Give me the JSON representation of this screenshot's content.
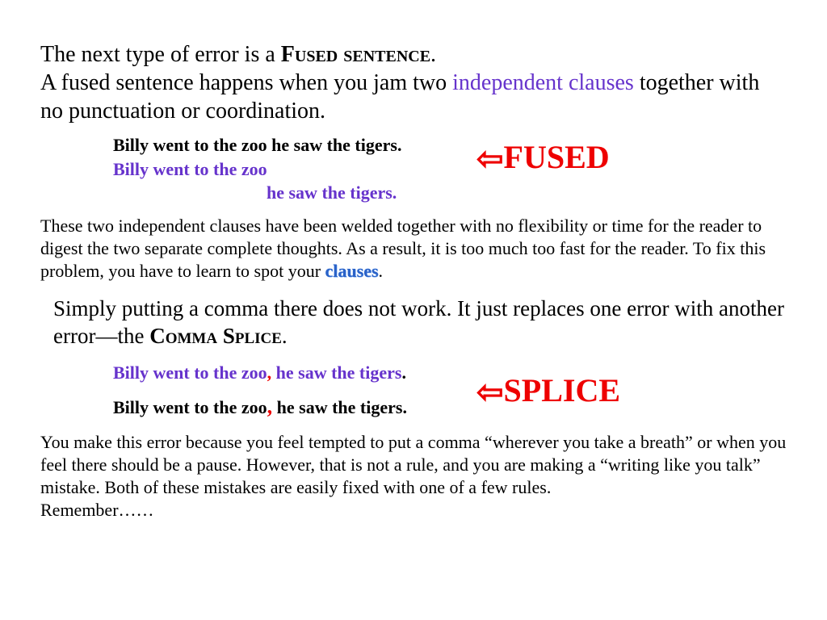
{
  "intro": {
    "line1_pre": "The next type of error is a ",
    "line1_term": "Fused sentence",
    "line1_post": ".",
    "line2_pre": "A fused sentence happens when you jam two ",
    "line2_term": "independent clauses",
    "line2_post": " together with no punctuation or coordination."
  },
  "example1": {
    "full": "Billy went to the zoo he saw the tigers.",
    "clause1": "Billy went to the zoo",
    "clause2": "he saw the tigers."
  },
  "callout1": {
    "arrow": "⇦",
    "label": "FUSED"
  },
  "para1": {
    "pre": "These two independent clauses have been welded together with no flexibility or time for the reader to digest the two separate complete thoughts.  As a result, it is too much too fast for the reader.  To fix this problem, you have to learn to spot your ",
    "term": "clauses",
    "post": "."
  },
  "mid": {
    "pre": "Simply putting a comma there does not work.  It just replaces one error with another error—the ",
    "term": "Comma Splice",
    "post": "."
  },
  "example2": {
    "p_clause1": "Billy went to the zoo",
    "p_comma": ",",
    "p_clause2": " he saw the tigers",
    "p_end": ".",
    "b_clause1": "Billy went to the zoo",
    "b_comma": ",",
    "b_clause2": " he saw the tigers."
  },
  "callout2": {
    "arrow": "⇦",
    "label": "SPLICE"
  },
  "para2": "You make this error because you feel tempted to put a comma “wherever you take a breath” or when you feel there should be a pause.  However, that is not a rule, and you are making a “writing like you talk” mistake.  Both of these mistakes are easily fixed with one of a few rules.",
  "remember": "Remember……"
}
